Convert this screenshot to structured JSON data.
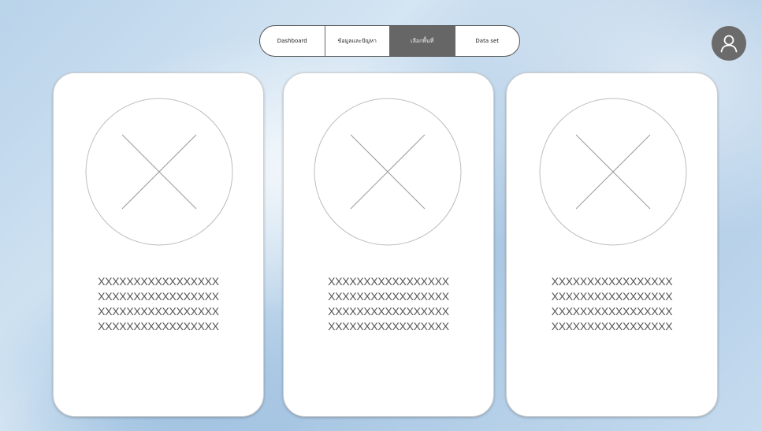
{
  "nav": {
    "tabs": [
      {
        "label": "Dashboard",
        "active": false
      },
      {
        "label": "ข้อมูลและปัญหา",
        "active": false
      },
      {
        "label": "เลือกพื้นที่",
        "active": true
      },
      {
        "label": "Data set",
        "active": false
      }
    ],
    "active_color": "#666666"
  },
  "avatar": {
    "icon": "user-icon",
    "color": "#6b6b6b"
  },
  "cards": [
    {
      "image_icon": "image-placeholder-icon",
      "lines": [
        "XXXXXXXXXXXXXXXXX",
        "XXXXXXXXXXXXXXXXX",
        "XXXXXXXXXXXXXXXXX",
        "XXXXXXXXXXXXXXXXX"
      ]
    },
    {
      "image_icon": "image-placeholder-icon",
      "lines": [
        "XXXXXXXXXXXXXXXXX",
        "XXXXXXXXXXXXXXXXX",
        "XXXXXXXXXXXXXXXXX",
        "XXXXXXXXXXXXXXXXX"
      ]
    },
    {
      "image_icon": "image-placeholder-icon",
      "lines": [
        "XXXXXXXXXXXXXXXXX",
        "XXXXXXXXXXXXXXXXX",
        "XXXXXXXXXXXXXXXXX",
        "XXXXXXXXXXXXXXXXX"
      ]
    }
  ]
}
